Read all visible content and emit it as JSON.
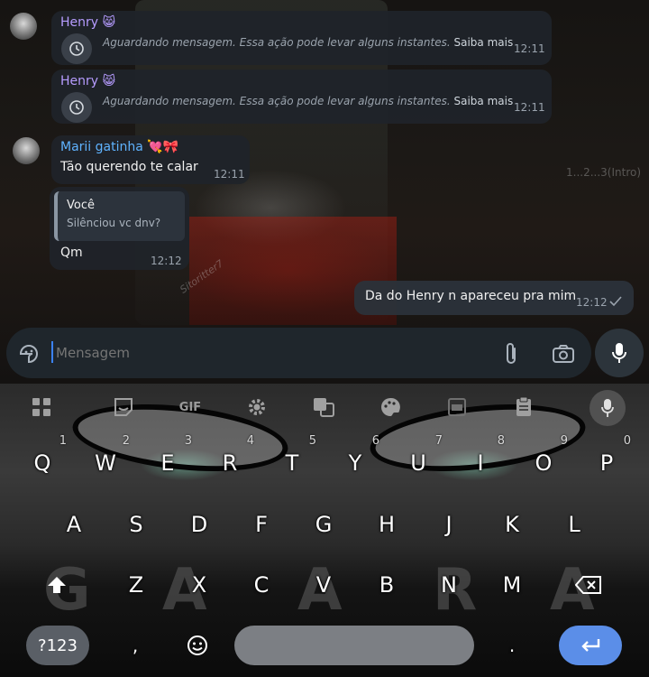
{
  "chat": {
    "messages": [
      {
        "sender": "Henry 😸",
        "waiting_text": "Aguardando mensagem. Essa ação pode levar alguns instantes.",
        "learn_more": "Saiba mais",
        "time": "12:11"
      },
      {
        "sender": "Henry 😸",
        "waiting_text": "Aguardando mensagem. Essa ação pode levar alguns instantes.",
        "learn_more": "Saiba mais",
        "time": "12:11"
      },
      {
        "sender": "Marii gatinha 💘🎀",
        "text": "Tão querendo te calar",
        "time": "12:11"
      },
      {
        "quote_author": "Você",
        "quote_text": "Silênciou vc dnv?",
        "text": "Qm",
        "time": "12:12"
      },
      {
        "text": "Da do Henry n apareceu pra mim",
        "time": "12:12",
        "status": "sent-check"
      }
    ],
    "wallpaper_text": {
      "intro": "1...2...3(Intro)",
      "signature": "Sitoritter7"
    },
    "colors": {
      "henry": "#b69cff",
      "marii": "#5fb3ff",
      "bubble": "#1f242a",
      "accent": "#3b82f6"
    }
  },
  "composer": {
    "placeholder": "Mensagem",
    "icons": [
      "sticker-icon",
      "attach-icon",
      "camera-icon",
      "mic-icon"
    ]
  },
  "keyboard": {
    "toolbar": {
      "gif_label": "GIF",
      "icons": [
        "apps-grid-icon",
        "sticker-icon",
        "gif-icon",
        "settings-icon",
        "translate-icon",
        "theme-icon",
        "floating-keyboard-icon",
        "clipboard-icon",
        "mic-icon"
      ]
    },
    "row1": [
      {
        "key": "Q",
        "hint": "1"
      },
      {
        "key": "W",
        "hint": "2"
      },
      {
        "key": "E",
        "hint": "3"
      },
      {
        "key": "R",
        "hint": "4"
      },
      {
        "key": "T",
        "hint": "5"
      },
      {
        "key": "Y",
        "hint": "6"
      },
      {
        "key": "U",
        "hint": "7"
      },
      {
        "key": "I",
        "hint": "8"
      },
      {
        "key": "O",
        "hint": "9"
      },
      {
        "key": "P",
        "hint": "0"
      }
    ],
    "row2": [
      "A",
      "S",
      "D",
      "F",
      "G",
      "H",
      "J",
      "K",
      "L"
    ],
    "row3": [
      "Z",
      "X",
      "C",
      "V",
      "B",
      "N",
      "M"
    ],
    "bottom": {
      "symbols_label": "?123",
      "comma_label": ",",
      "period_label": "."
    },
    "background_letters": [
      "G",
      "A",
      "A",
      "R",
      "A"
    ]
  }
}
